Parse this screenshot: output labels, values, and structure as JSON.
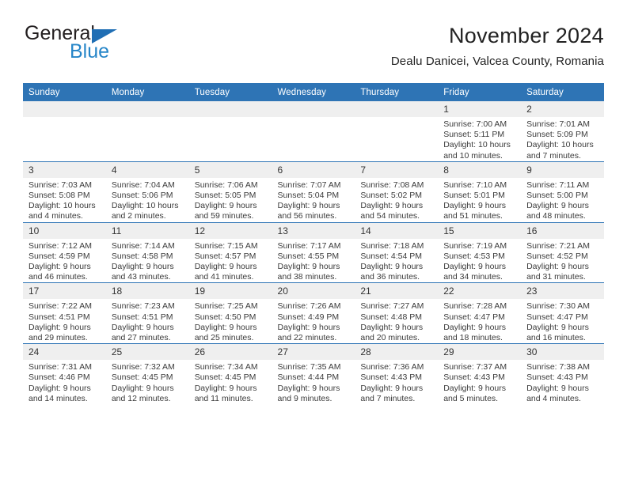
{
  "logo": {
    "word_one": "General",
    "word_two": "Blue",
    "triangle_color": "#1f6eb4",
    "blue_text_color": "#2585c8"
  },
  "header": {
    "title": "November 2024",
    "subtitle": "Dealu Danicei, Valcea County, Romania"
  },
  "theme": {
    "header_blue": "#2e74b5",
    "daynum_band": "#efefef",
    "text": "#3b3b3b"
  },
  "calendar": {
    "weekday_headers": [
      "Sunday",
      "Monday",
      "Tuesday",
      "Wednesday",
      "Thursday",
      "Friday",
      "Saturday"
    ],
    "weeks": [
      [
        {
          "day": "",
          "sunrise": "",
          "sunset": "",
          "daylight_line1": "",
          "daylight_line2": ""
        },
        {
          "day": "",
          "sunrise": "",
          "sunset": "",
          "daylight_line1": "",
          "daylight_line2": ""
        },
        {
          "day": "",
          "sunrise": "",
          "sunset": "",
          "daylight_line1": "",
          "daylight_line2": ""
        },
        {
          "day": "",
          "sunrise": "",
          "sunset": "",
          "daylight_line1": "",
          "daylight_line2": ""
        },
        {
          "day": "",
          "sunrise": "",
          "sunset": "",
          "daylight_line1": "",
          "daylight_line2": ""
        },
        {
          "day": "1",
          "sunrise": "Sunrise: 7:00 AM",
          "sunset": "Sunset: 5:11 PM",
          "daylight_line1": "Daylight: 10 hours",
          "daylight_line2": "and 10 minutes."
        },
        {
          "day": "2",
          "sunrise": "Sunrise: 7:01 AM",
          "sunset": "Sunset: 5:09 PM",
          "daylight_line1": "Daylight: 10 hours",
          "daylight_line2": "and 7 minutes."
        }
      ],
      [
        {
          "day": "3",
          "sunrise": "Sunrise: 7:03 AM",
          "sunset": "Sunset: 5:08 PM",
          "daylight_line1": "Daylight: 10 hours",
          "daylight_line2": "and 4 minutes."
        },
        {
          "day": "4",
          "sunrise": "Sunrise: 7:04 AM",
          "sunset": "Sunset: 5:06 PM",
          "daylight_line1": "Daylight: 10 hours",
          "daylight_line2": "and 2 minutes."
        },
        {
          "day": "5",
          "sunrise": "Sunrise: 7:06 AM",
          "sunset": "Sunset: 5:05 PM",
          "daylight_line1": "Daylight: 9 hours",
          "daylight_line2": "and 59 minutes."
        },
        {
          "day": "6",
          "sunrise": "Sunrise: 7:07 AM",
          "sunset": "Sunset: 5:04 PM",
          "daylight_line1": "Daylight: 9 hours",
          "daylight_line2": "and 56 minutes."
        },
        {
          "day": "7",
          "sunrise": "Sunrise: 7:08 AM",
          "sunset": "Sunset: 5:02 PM",
          "daylight_line1": "Daylight: 9 hours",
          "daylight_line2": "and 54 minutes."
        },
        {
          "day": "8",
          "sunrise": "Sunrise: 7:10 AM",
          "sunset": "Sunset: 5:01 PM",
          "daylight_line1": "Daylight: 9 hours",
          "daylight_line2": "and 51 minutes."
        },
        {
          "day": "9",
          "sunrise": "Sunrise: 7:11 AM",
          "sunset": "Sunset: 5:00 PM",
          "daylight_line1": "Daylight: 9 hours",
          "daylight_line2": "and 48 minutes."
        }
      ],
      [
        {
          "day": "10",
          "sunrise": "Sunrise: 7:12 AM",
          "sunset": "Sunset: 4:59 PM",
          "daylight_line1": "Daylight: 9 hours",
          "daylight_line2": "and 46 minutes."
        },
        {
          "day": "11",
          "sunrise": "Sunrise: 7:14 AM",
          "sunset": "Sunset: 4:58 PM",
          "daylight_line1": "Daylight: 9 hours",
          "daylight_line2": "and 43 minutes."
        },
        {
          "day": "12",
          "sunrise": "Sunrise: 7:15 AM",
          "sunset": "Sunset: 4:57 PM",
          "daylight_line1": "Daylight: 9 hours",
          "daylight_line2": "and 41 minutes."
        },
        {
          "day": "13",
          "sunrise": "Sunrise: 7:17 AM",
          "sunset": "Sunset: 4:55 PM",
          "daylight_line1": "Daylight: 9 hours",
          "daylight_line2": "and 38 minutes."
        },
        {
          "day": "14",
          "sunrise": "Sunrise: 7:18 AM",
          "sunset": "Sunset: 4:54 PM",
          "daylight_line1": "Daylight: 9 hours",
          "daylight_line2": "and 36 minutes."
        },
        {
          "day": "15",
          "sunrise": "Sunrise: 7:19 AM",
          "sunset": "Sunset: 4:53 PM",
          "daylight_line1": "Daylight: 9 hours",
          "daylight_line2": "and 34 minutes."
        },
        {
          "day": "16",
          "sunrise": "Sunrise: 7:21 AM",
          "sunset": "Sunset: 4:52 PM",
          "daylight_line1": "Daylight: 9 hours",
          "daylight_line2": "and 31 minutes."
        }
      ],
      [
        {
          "day": "17",
          "sunrise": "Sunrise: 7:22 AM",
          "sunset": "Sunset: 4:51 PM",
          "daylight_line1": "Daylight: 9 hours",
          "daylight_line2": "and 29 minutes."
        },
        {
          "day": "18",
          "sunrise": "Sunrise: 7:23 AM",
          "sunset": "Sunset: 4:51 PM",
          "daylight_line1": "Daylight: 9 hours",
          "daylight_line2": "and 27 minutes."
        },
        {
          "day": "19",
          "sunrise": "Sunrise: 7:25 AM",
          "sunset": "Sunset: 4:50 PM",
          "daylight_line1": "Daylight: 9 hours",
          "daylight_line2": "and 25 minutes."
        },
        {
          "day": "20",
          "sunrise": "Sunrise: 7:26 AM",
          "sunset": "Sunset: 4:49 PM",
          "daylight_line1": "Daylight: 9 hours",
          "daylight_line2": "and 22 minutes."
        },
        {
          "day": "21",
          "sunrise": "Sunrise: 7:27 AM",
          "sunset": "Sunset: 4:48 PM",
          "daylight_line1": "Daylight: 9 hours",
          "daylight_line2": "and 20 minutes."
        },
        {
          "day": "22",
          "sunrise": "Sunrise: 7:28 AM",
          "sunset": "Sunset: 4:47 PM",
          "daylight_line1": "Daylight: 9 hours",
          "daylight_line2": "and 18 minutes."
        },
        {
          "day": "23",
          "sunrise": "Sunrise: 7:30 AM",
          "sunset": "Sunset: 4:47 PM",
          "daylight_line1": "Daylight: 9 hours",
          "daylight_line2": "and 16 minutes."
        }
      ],
      [
        {
          "day": "24",
          "sunrise": "Sunrise: 7:31 AM",
          "sunset": "Sunset: 4:46 PM",
          "daylight_line1": "Daylight: 9 hours",
          "daylight_line2": "and 14 minutes."
        },
        {
          "day": "25",
          "sunrise": "Sunrise: 7:32 AM",
          "sunset": "Sunset: 4:45 PM",
          "daylight_line1": "Daylight: 9 hours",
          "daylight_line2": "and 12 minutes."
        },
        {
          "day": "26",
          "sunrise": "Sunrise: 7:34 AM",
          "sunset": "Sunset: 4:45 PM",
          "daylight_line1": "Daylight: 9 hours",
          "daylight_line2": "and 11 minutes."
        },
        {
          "day": "27",
          "sunrise": "Sunrise: 7:35 AM",
          "sunset": "Sunset: 4:44 PM",
          "daylight_line1": "Daylight: 9 hours",
          "daylight_line2": "and 9 minutes."
        },
        {
          "day": "28",
          "sunrise": "Sunrise: 7:36 AM",
          "sunset": "Sunset: 4:43 PM",
          "daylight_line1": "Daylight: 9 hours",
          "daylight_line2": "and 7 minutes."
        },
        {
          "day": "29",
          "sunrise": "Sunrise: 7:37 AM",
          "sunset": "Sunset: 4:43 PM",
          "daylight_line1": "Daylight: 9 hours",
          "daylight_line2": "and 5 minutes."
        },
        {
          "day": "30",
          "sunrise": "Sunrise: 7:38 AM",
          "sunset": "Sunset: 4:43 PM",
          "daylight_line1": "Daylight: 9 hours",
          "daylight_line2": "and 4 minutes."
        }
      ]
    ]
  }
}
